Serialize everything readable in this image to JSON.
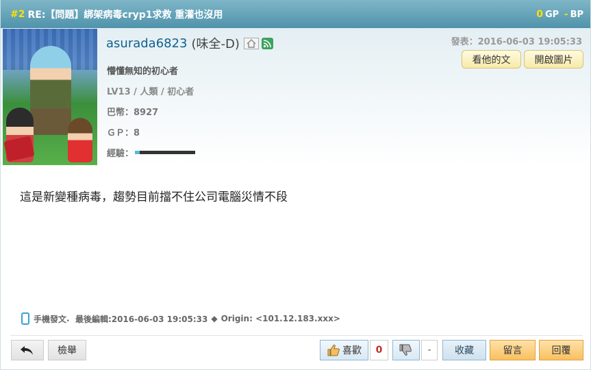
{
  "header": {
    "floor": "#2",
    "title": "RE:【問題】綁架病毒cryp1求救 重灌也沒用",
    "gp_value": "0",
    "gp_label": "GP",
    "bp_value": "-",
    "bp_label": "BP"
  },
  "user": {
    "username": "asurada6823",
    "nickname": "(味全-D)",
    "home_icon": "home-icon",
    "rss_icon": "rss-icon",
    "signature": "懵懂無知的初心者",
    "level_line": "LV13 / 人類 / 初心者",
    "coins_line": "巴幣：8927",
    "gp_line": "ＧＰ：8",
    "exp_label": "經驗：",
    "exp_fraction": 0.08
  },
  "post": {
    "time": "發表：2016-06-03 19:05:33",
    "view_his_posts": "看他的文",
    "open_images": "開啟圖片",
    "body": "這是新變種病毒，趨勢目前擋不住公司電腦災情不段",
    "meta_device": "手機發文",
    "meta_edit": "最後編輯:2016-06-03 19:05:33",
    "meta_diamond": "◆",
    "meta_origin": "Origin: <101.12.183.xxx>"
  },
  "actions": {
    "report": "檢舉",
    "like": "喜歡",
    "like_count": "0",
    "dislike_count": "-",
    "favorite": "收藏",
    "comment": "留言",
    "reply": "回覆"
  },
  "colors": {
    "header_bg": "#4f93ab",
    "header_accent": "#ffe000",
    "username": "#11608e",
    "orange_button": "#f8c060"
  }
}
